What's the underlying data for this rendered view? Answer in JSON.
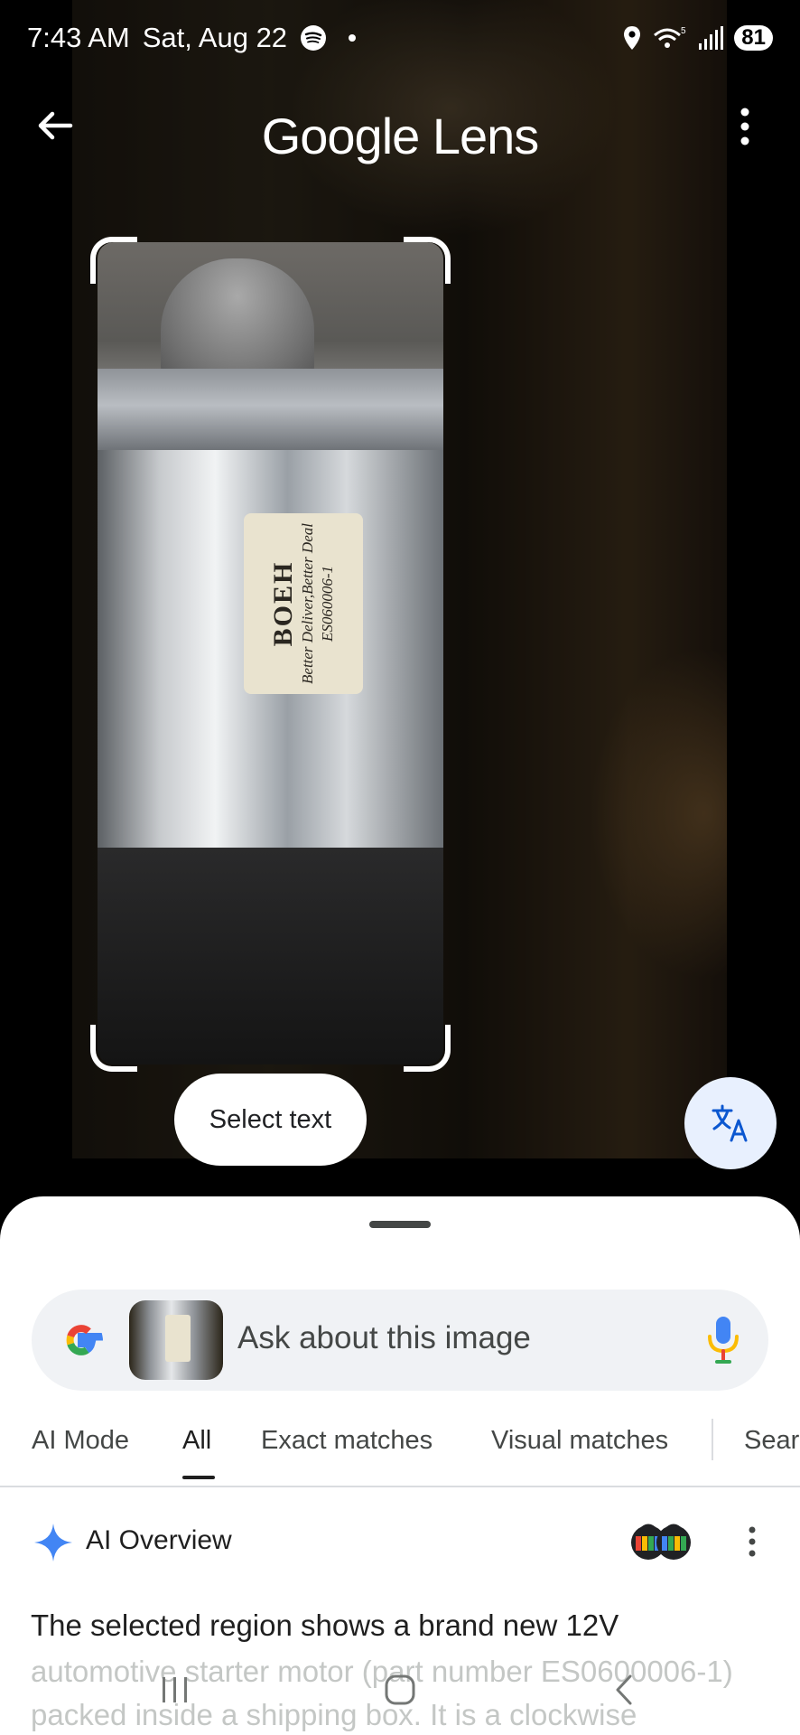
{
  "status_bar": {
    "time": "7:43 AM",
    "date": "Sat, Aug 22",
    "battery": "81"
  },
  "app_bar": {
    "title": "Google Lens"
  },
  "image": {
    "label_brand": "BOEH",
    "label_tagline": "Better Deliver,Better Deal",
    "label_part": "ES060006-1"
  },
  "floating": {
    "select_text_label": "Select text"
  },
  "search": {
    "placeholder": "Ask about this image"
  },
  "tabs": [
    {
      "label": "AI Mode",
      "active": false
    },
    {
      "label": "All",
      "active": true
    },
    {
      "label": "Exact matches",
      "active": false
    },
    {
      "label": "Visual matches",
      "active": false
    },
    {
      "label": "Sear",
      "active": false
    }
  ],
  "ai_overview": {
    "title": "AI Overview",
    "text_line1": "The selected region shows a brand new 12V",
    "text_faded": "automotive starter motor (part number ES0600006-1) packed inside a shipping box. It is a clockwise"
  },
  "colors": {
    "accent_blue": "#1a73e8",
    "sheet_bg": "#ffffff",
    "search_bg": "#f0f2f5",
    "translate_bg": "#e8f0fe"
  },
  "icons": {
    "back": "arrow-left",
    "more": "vertical-dots",
    "translate": "translate",
    "mic": "microphone",
    "google": "google-g",
    "sparkle": "ai-sparkle"
  }
}
